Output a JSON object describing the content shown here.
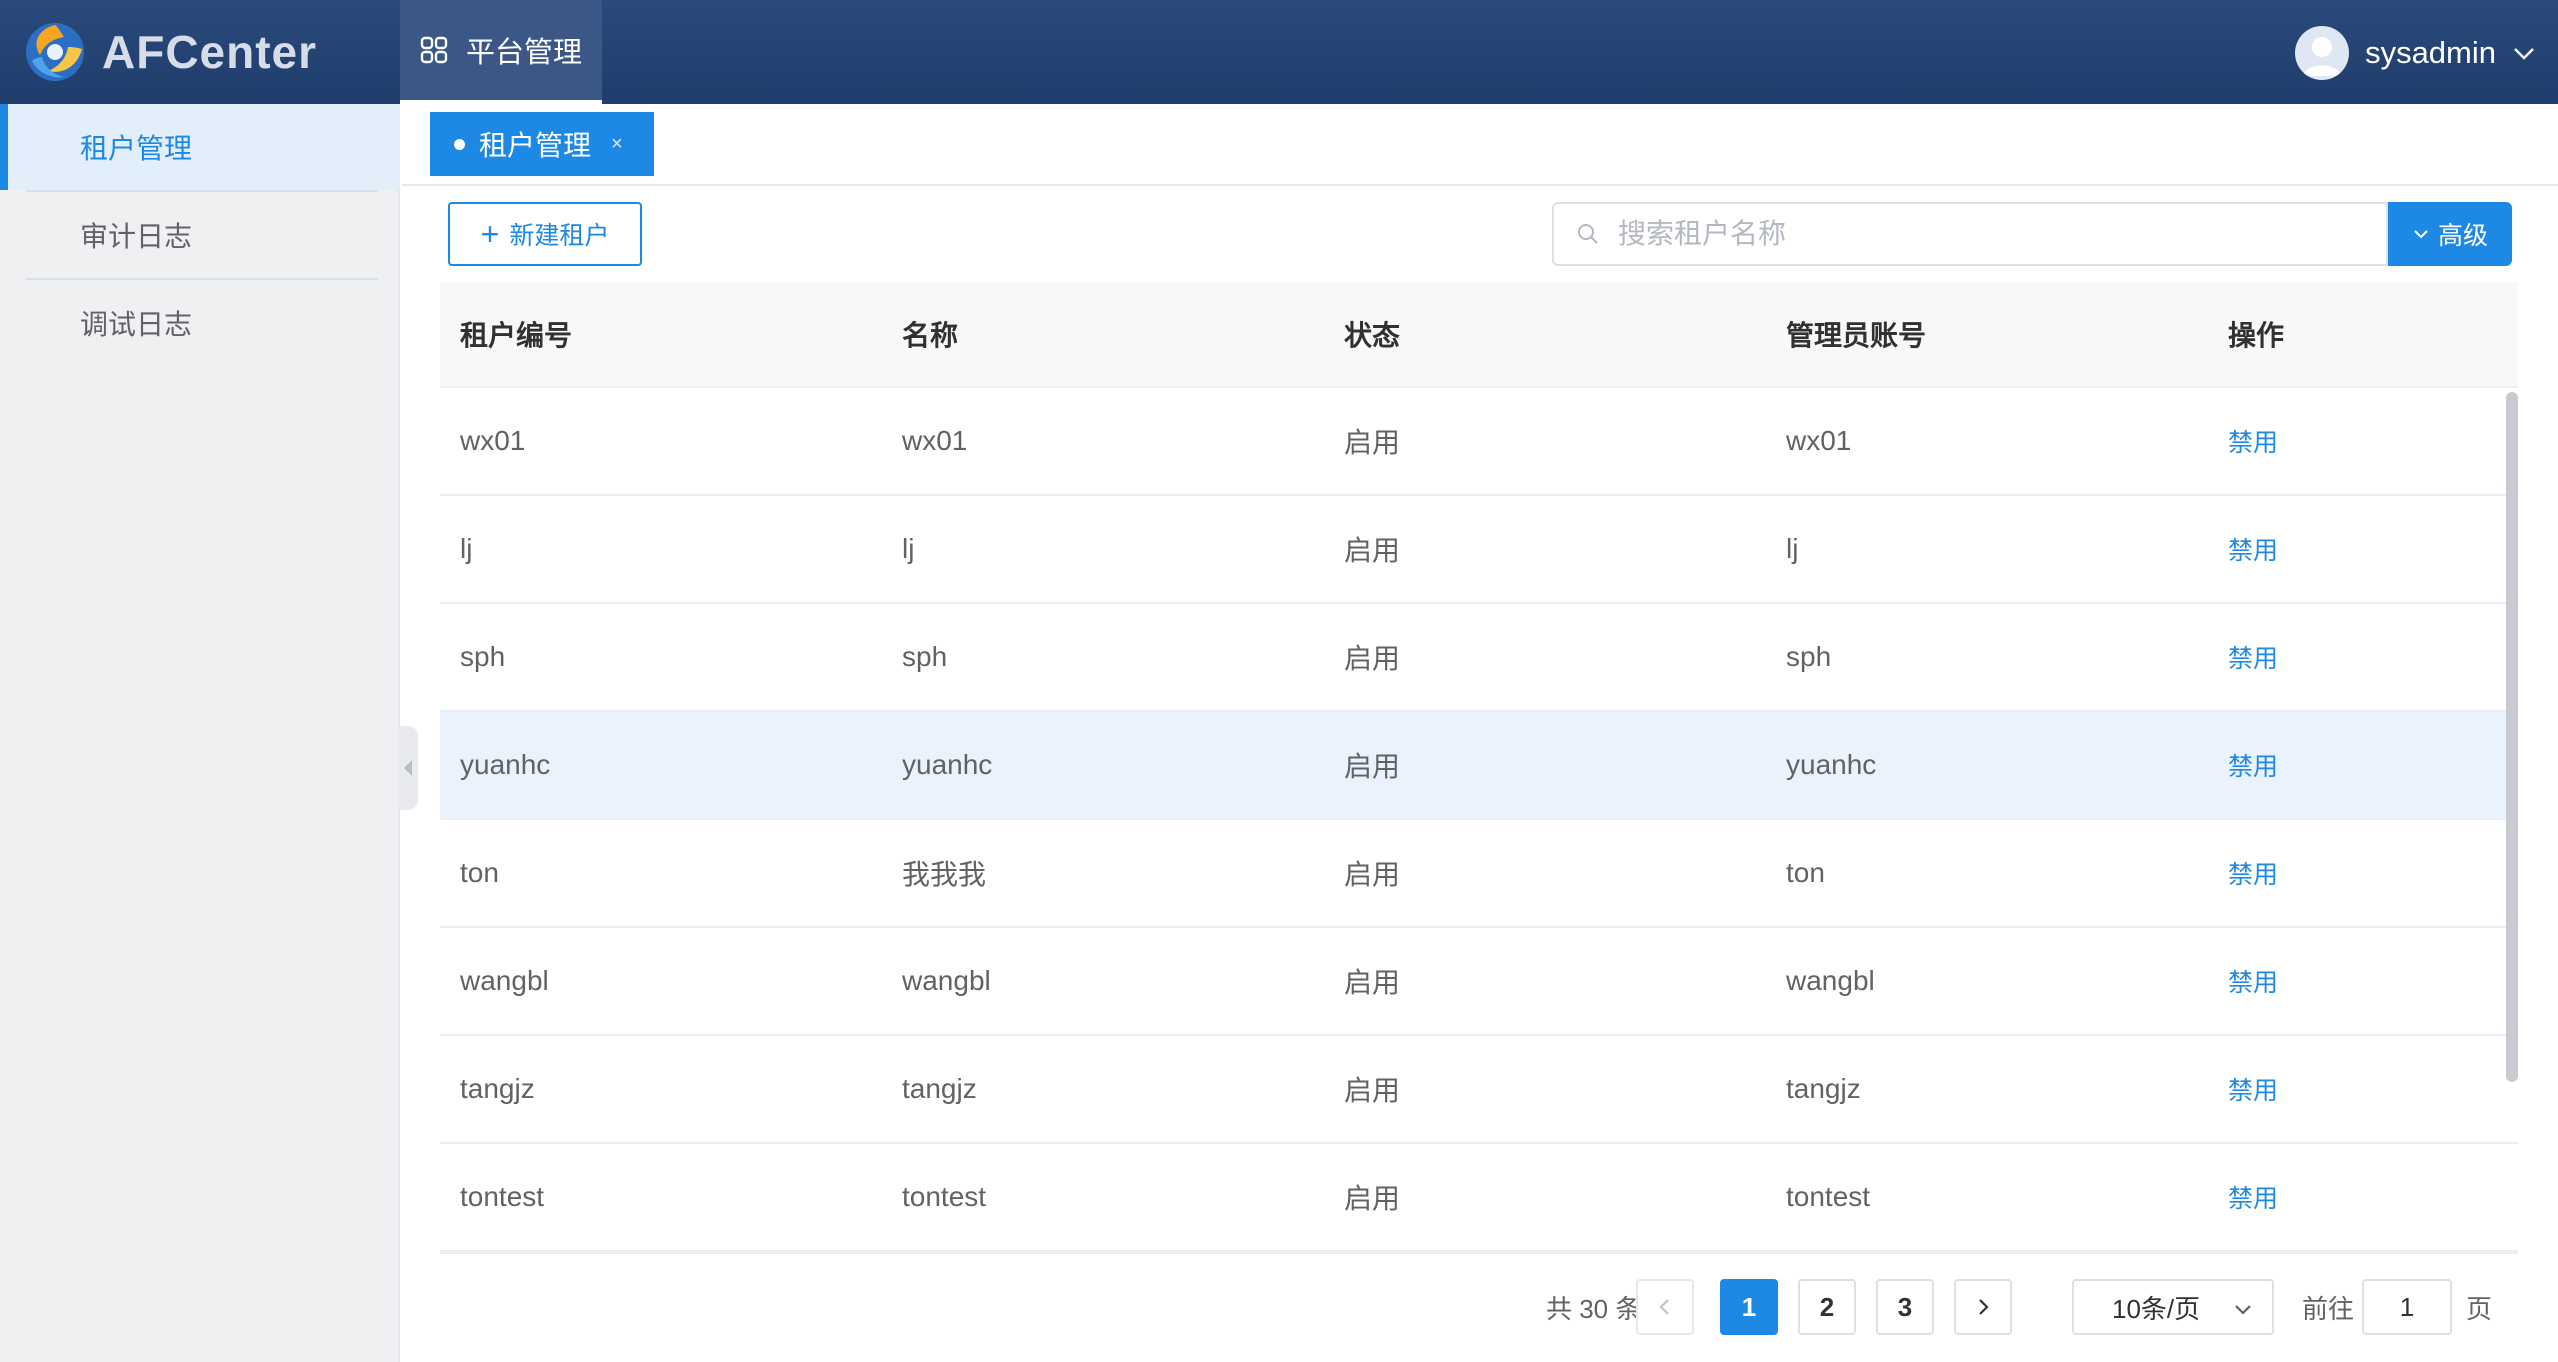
{
  "app": {
    "name": "AFCenter"
  },
  "header": {
    "nav_tab": "平台管理",
    "user": {
      "name": "sysadmin"
    }
  },
  "sidebar": {
    "items": [
      {
        "label": "租户管理",
        "active": true
      },
      {
        "label": "审计日志",
        "active": false
      },
      {
        "label": "调试日志",
        "active": false
      }
    ]
  },
  "tabs": [
    {
      "label": "租户管理",
      "close": "×"
    }
  ],
  "toolbar": {
    "new_label": "新建租户",
    "search_placeholder": "搜索租户名称",
    "search_value": "",
    "advanced_label": "高级"
  },
  "table": {
    "headers": [
      "租户编号",
      "名称",
      "状态",
      "管理员账号",
      "操作"
    ],
    "rows": [
      {
        "id": "wx01",
        "name": "wx01",
        "status": "启用",
        "admin": "wx01",
        "action": "禁用"
      },
      {
        "id": "lj",
        "name": "lj",
        "status": "启用",
        "admin": "lj",
        "action": "禁用"
      },
      {
        "id": "sph",
        "name": "sph",
        "status": "启用",
        "admin": "sph",
        "action": "禁用"
      },
      {
        "id": "yuanhc",
        "name": "yuanhc",
        "status": "启用",
        "admin": "yuanhc",
        "action": "禁用",
        "highlighted": true
      },
      {
        "id": "ton",
        "name": "我我我",
        "status": "启用",
        "admin": "ton",
        "action": "禁用"
      },
      {
        "id": "wangbl",
        "name": "wangbl",
        "status": "启用",
        "admin": "wangbl",
        "action": "禁用"
      },
      {
        "id": "tangjz",
        "name": "tangjz",
        "status": "启用",
        "admin": "tangjz",
        "action": "禁用"
      },
      {
        "id": "tontest",
        "name": "tontest",
        "status": "启用",
        "admin": "tontest",
        "action": "禁用"
      }
    ]
  },
  "pagination": {
    "total_text": "共 30 条",
    "pages": [
      "1",
      "2",
      "3"
    ],
    "current_page": "1",
    "page_size": "10条/页",
    "goto_prefix": "前往",
    "goto_value": "1",
    "goto_suffix": "页"
  },
  "colors": {
    "primary": "#1e88e5",
    "header": "#1f3d6b",
    "row_highlight": "#e9f2fd"
  }
}
